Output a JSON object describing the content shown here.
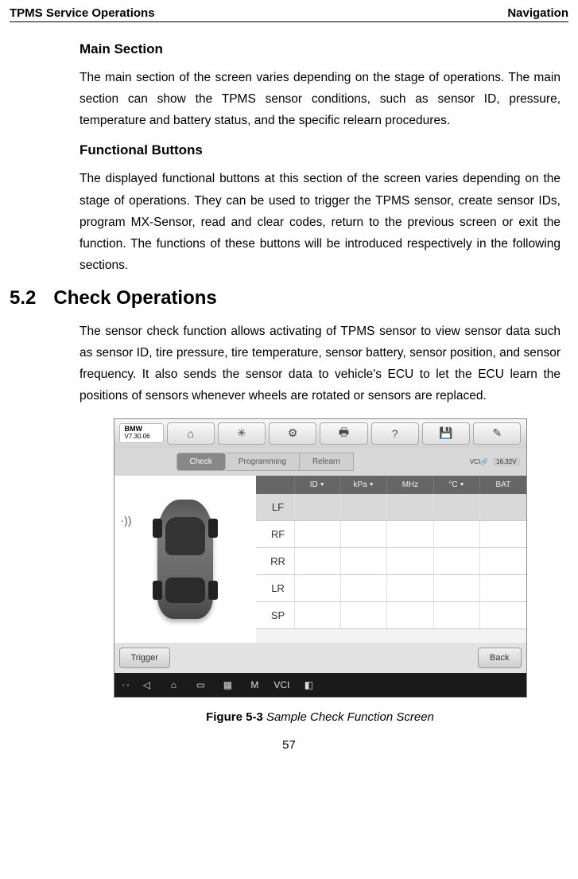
{
  "header": {
    "left": "TPMS Service Operations",
    "right": "Navigation"
  },
  "sections": {
    "main_section": {
      "title": "Main Section",
      "para": "The main section of the screen varies depending on the stage of operations. The main section can show the TPMS sensor conditions, such as sensor ID, pressure, temperature and battery status, and the specific relearn procedures."
    },
    "functional_buttons": {
      "title": "Functional Buttons",
      "para": "The displayed functional buttons at this section of the screen varies depending on the stage of operations. They can be used to trigger the TPMS sensor, create sensor IDs, program MX-Sensor, read and clear codes, return to the previous screen or exit the function. The functions of these buttons will be introduced respectively in the following sections."
    },
    "check_ops": {
      "num": "5.2",
      "title": "Check Operations",
      "para": "The sensor check function allows activating of TPMS sensor to view sensor data such as sensor ID, tire pressure, tire temperature, sensor battery, sensor position, and sensor frequency. It also sends the sensor data to vehicle's ECU to let the ECU learn the positions of sensors whenever wheels are rotated or sensors are replaced."
    }
  },
  "figure": {
    "brand": "BMW",
    "brand_sub": "V7.30.06",
    "toolbar_icons": [
      "home-icon",
      "gear-icon",
      "settings-icon",
      "print-icon",
      "help-icon",
      "save-icon",
      "edit-icon"
    ],
    "tabs": {
      "check": "Check",
      "programming": "Programming",
      "relearn": "Relearn"
    },
    "vci_label": "VCI",
    "voltage": "16.32V",
    "columns": {
      "id": "ID",
      "kpa": "kPa",
      "mhz": "MHz",
      "c": "°C",
      "bat": "BAT"
    },
    "rows": [
      "LF",
      "RF",
      "RR",
      "LR",
      "SP"
    ],
    "btn_trigger": "Trigger",
    "btn_back": "Back",
    "nav_icons": [
      "back-icon",
      "home-icon",
      "recent-icon",
      "apps-icon",
      "app-m-icon",
      "vci-nav-icon",
      "camera-icon"
    ],
    "caption_label": "Figure 5-3",
    "caption_text": "Sample Check Function Screen"
  },
  "page_number": "57"
}
